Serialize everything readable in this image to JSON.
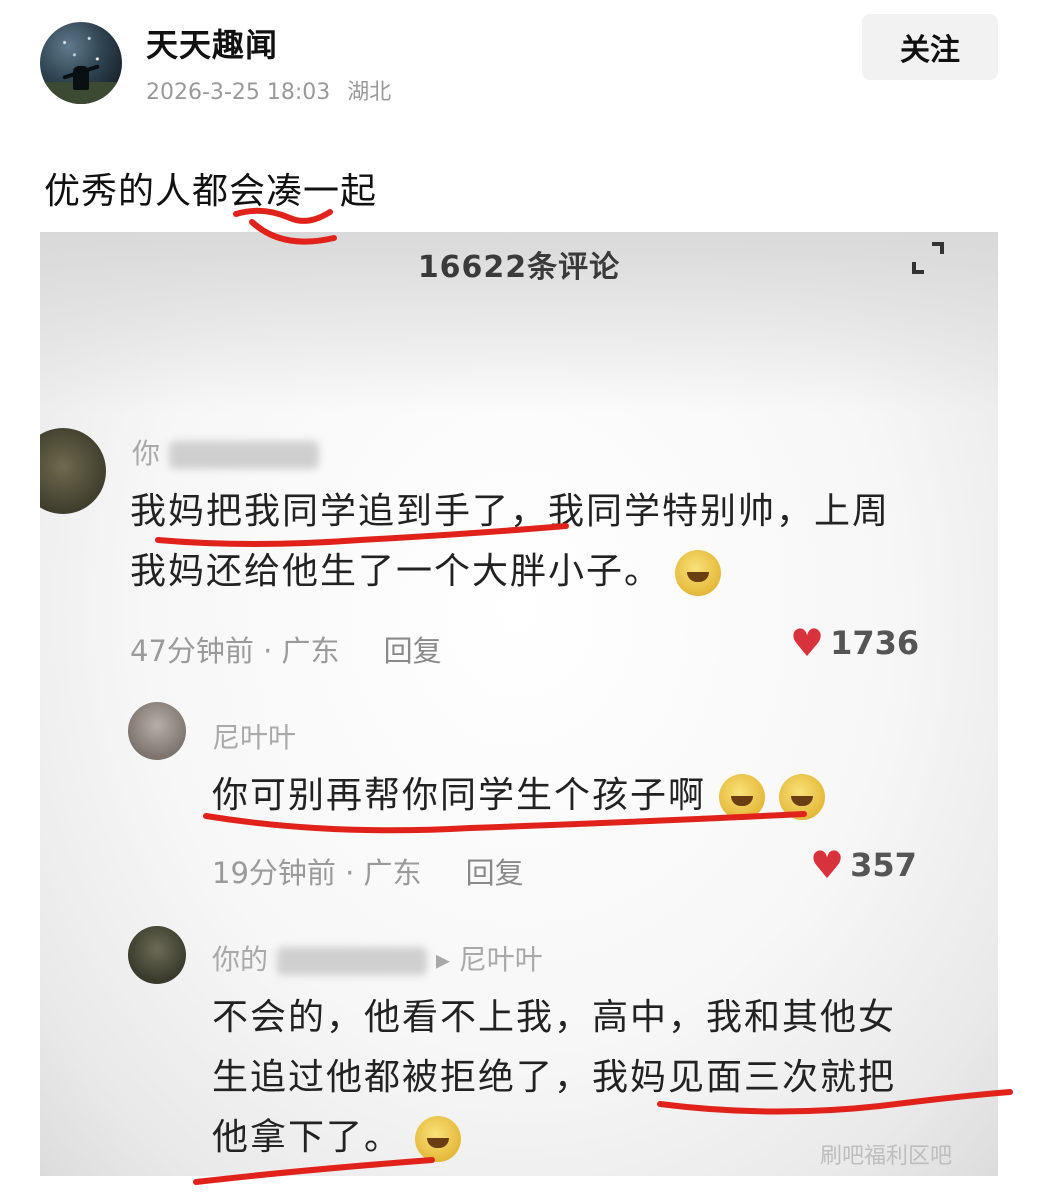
{
  "header": {
    "author_name": "天天趣闻",
    "timestamp": "2026-3-25 18:03",
    "location": "湖北",
    "follow_label": "关注"
  },
  "post": {
    "text": "优秀的人都会凑一起"
  },
  "screenshot": {
    "comment_count": "16622条评论",
    "comments": [
      {
        "name_prefix": "你",
        "text_line1": "我妈把我同学追到手了，我同学特别帅，上周",
        "text_line2": "我妈还给他生了一个大胖小子。",
        "time": "47分钟前 · 广东",
        "reply_label": "回复",
        "likes": "1736"
      },
      {
        "name": "尼叶叶",
        "text_line1": "你可别再帮你同学生个孩子啊",
        "time": "19分钟前 · 广东",
        "reply_label": "回复",
        "likes": "357"
      },
      {
        "name_prefix": "你的",
        "reply_to": "▸ 尼叶叶",
        "text_line1": "不会的，他看不上我，高中，我和其他女",
        "text_line2": "生追过他都被拒绝了，我妈见面三次就把",
        "text_line3": "他拿下了。"
      }
    ],
    "watermark": "刷吧福利区吧"
  },
  "colors": {
    "annotation_red": "#e0221b",
    "like_red": "#d8323c"
  }
}
